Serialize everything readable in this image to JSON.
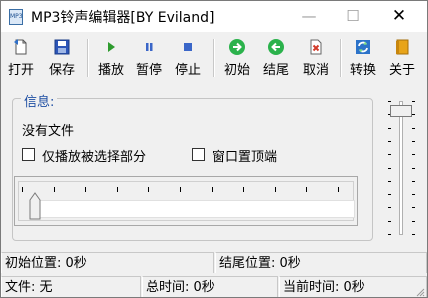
{
  "window": {
    "title": "MP3铃声编辑器[BY Eviland]",
    "icon_text": "MP3",
    "controls": {
      "minimize": "—",
      "maximize": "☐",
      "close": "✕"
    }
  },
  "toolbar": {
    "open_label": "打开",
    "save_label": "保存",
    "play_label": "播放",
    "pause_label": "暂停",
    "stop_label": "停止",
    "start_label": "初始",
    "end_label": "结尾",
    "cancel_label": "取消",
    "convert_label": "转换",
    "about_label": "关于"
  },
  "info": {
    "group_title": "信息:",
    "file_status": "没有文件",
    "play_selected_label": "仅播放被选择部分",
    "play_selected_checked": false,
    "topmost_label": "窗口置顶端",
    "topmost_checked": false
  },
  "position_slider": {
    "value": 0
  },
  "volume_slider": {
    "value": 1.0
  },
  "status": {
    "start_pos": "初始位置: 0秒",
    "end_pos": "结尾位置: 0秒",
    "file": "文件: 无",
    "total_time": "总时间: 0秒",
    "current_time": "当前时间: 0秒"
  },
  "colors": {
    "accent_blue": "#1e4ea3",
    "play_green": "#2e9b2e",
    "nav_green": "#2bb24c",
    "cancel_red": "#d23a2a",
    "stop_blue": "#3a66c8"
  }
}
